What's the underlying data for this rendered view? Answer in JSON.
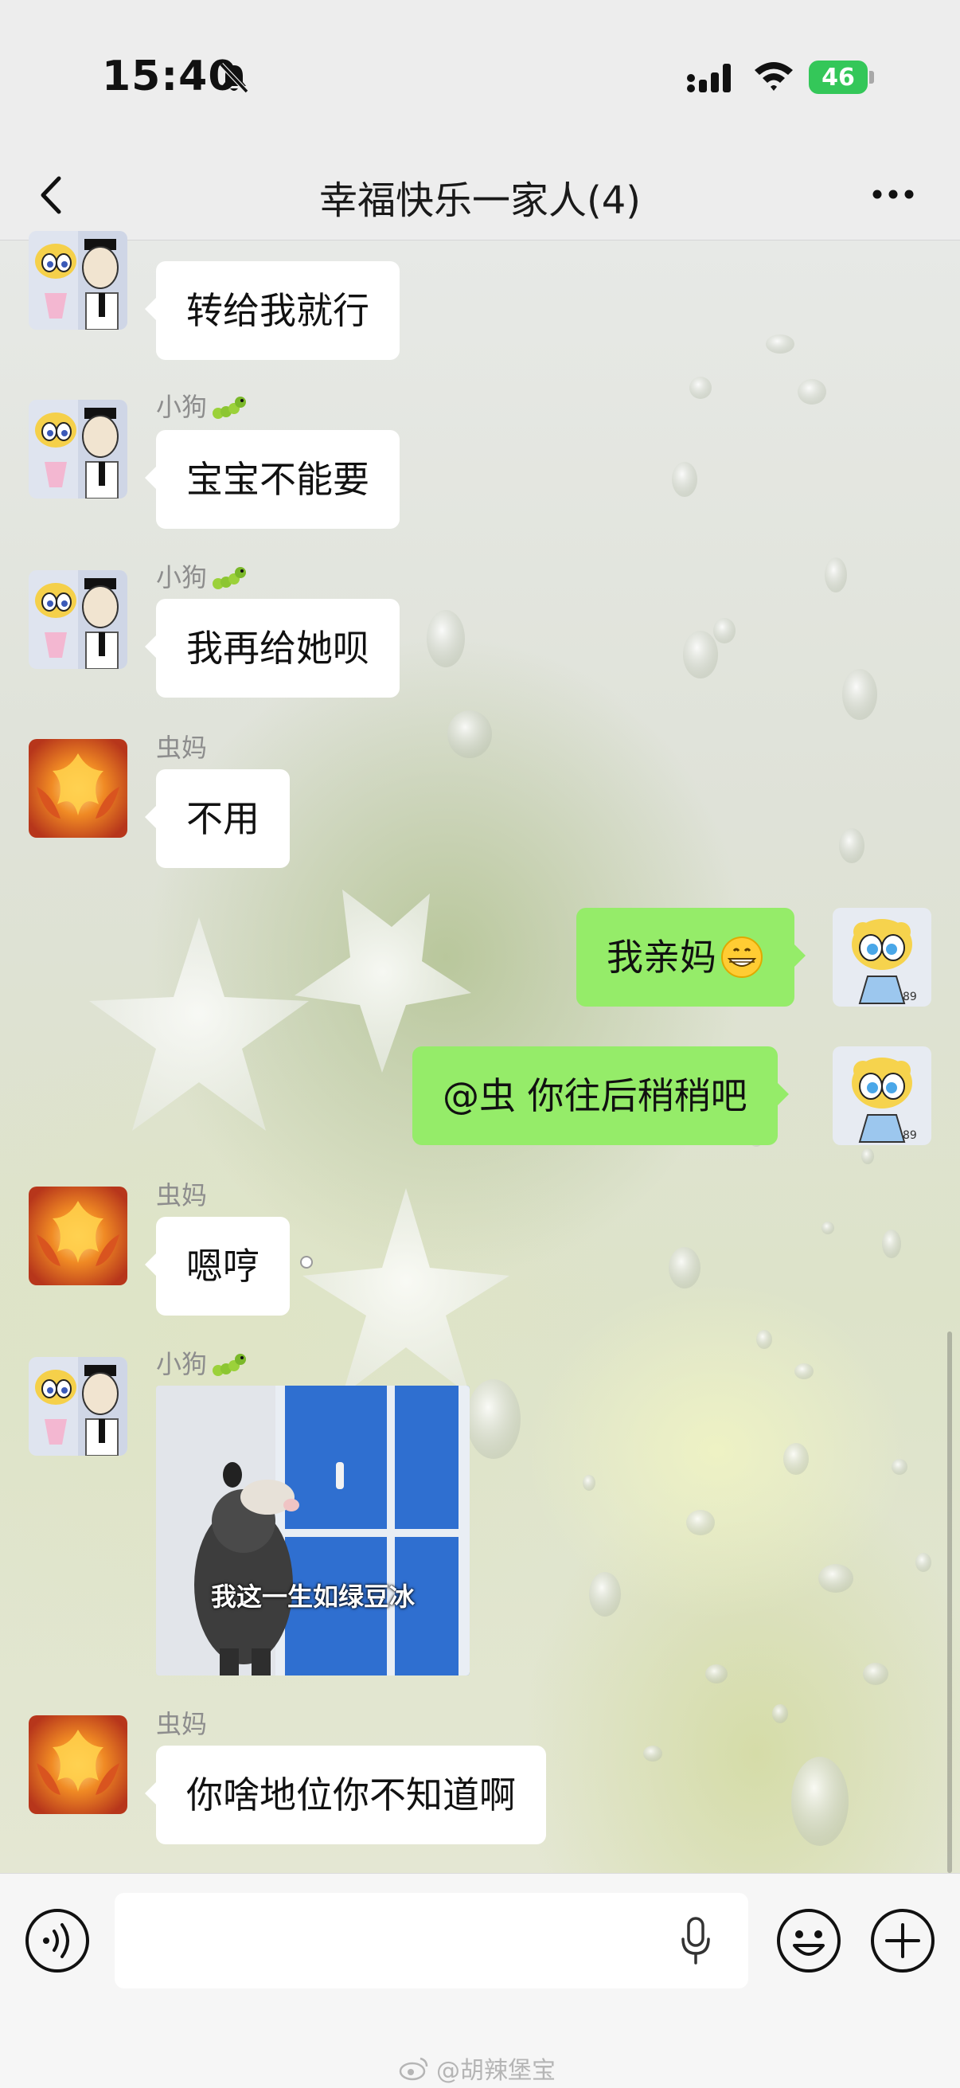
{
  "status_bar": {
    "time": "15:40",
    "battery_level": "46",
    "icons": [
      "bell-off-icon",
      "signal-icon",
      "wifi-icon",
      "battery-icon"
    ]
  },
  "header": {
    "back_icon": "chevron-left-icon",
    "title": "幸福快乐一家人(4)",
    "more_icon": "ellipsis-icon"
  },
  "messages": [
    {
      "sender": "小狗",
      "sender_emoji": "caterpillar-icon",
      "side": "left",
      "avatar": "cartoon-avatar",
      "text": "转给我就行"
    },
    {
      "sender": "小狗",
      "sender_emoji": "caterpillar-icon",
      "side": "left",
      "avatar": "cartoon-avatar",
      "text": "宝宝不能要"
    },
    {
      "sender": "小狗",
      "sender_emoji": "caterpillar-icon",
      "side": "left",
      "avatar": "cartoon-avatar",
      "text": "我再给她呗"
    },
    {
      "sender": "虫妈",
      "side": "left",
      "avatar": "phoenix-avatar",
      "text": "不用"
    },
    {
      "sender": "",
      "side": "right",
      "avatar": "bubbles-avatar",
      "text": "我亲妈",
      "trailing_emoji": "grinning-face-icon"
    },
    {
      "sender": "",
      "side": "right",
      "avatar": "bubbles-avatar",
      "text": "@虫 你往后稍稍吧"
    },
    {
      "sender": "虫妈",
      "side": "left",
      "avatar": "phoenix-avatar",
      "text": "嗯哼"
    },
    {
      "sender": "小狗",
      "sender_emoji": "caterpillar-icon",
      "side": "left",
      "avatar": "cartoon-avatar",
      "type": "sticker",
      "sticker_caption": "我这一生如绿豆冰"
    },
    {
      "sender": "虫妈",
      "side": "left",
      "avatar": "phoenix-avatar",
      "text": "你啥地位你不知道啊"
    }
  ],
  "input_bar": {
    "voice_icon": "voice-icon",
    "input_value": "",
    "mic_icon": "microphone-icon",
    "emoji_icon": "smiley-icon",
    "plus_icon": "plus-icon"
  },
  "watermark": "@胡辣堡宝",
  "colors": {
    "bubble_green": "#95ec69",
    "bubble_white": "#ffffff",
    "bar_bg": "#ededed",
    "battery_green": "#34c759"
  }
}
